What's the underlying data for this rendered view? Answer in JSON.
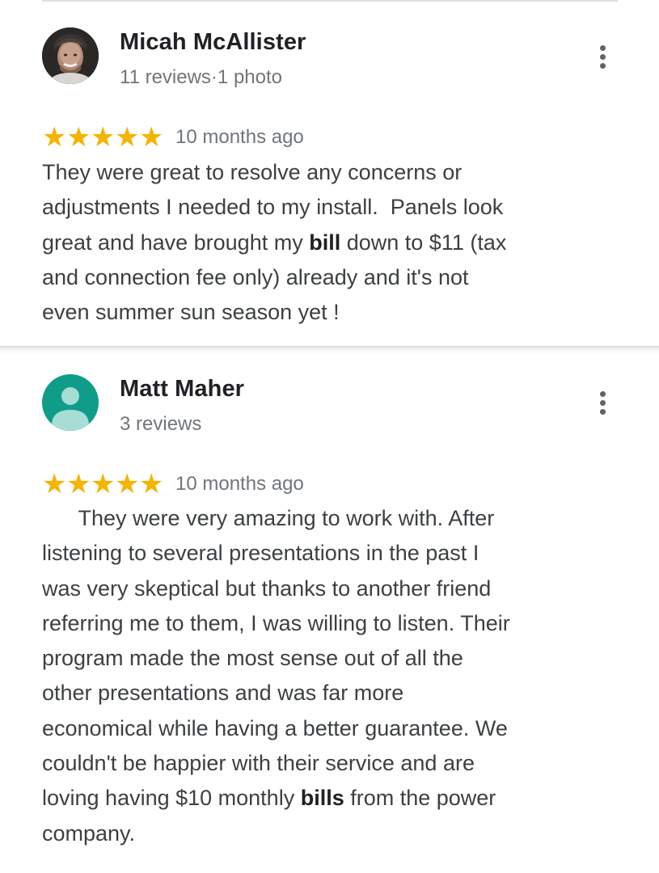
{
  "reviews": [
    {
      "reviewer_name": "Micah McAllister",
      "reviewer_meta": "11 reviews·1 photo",
      "rating": 5,
      "rating_stars": "★★★★★",
      "date": "10 months ago",
      "text_lines": [
        {
          "before": "They were great to resolve any concerns or",
          "bold": "",
          "after": ""
        },
        {
          "before": "adjustments I needed to my install.  Panels look",
          "bold": "",
          "after": ""
        },
        {
          "before": "great and have brought my ",
          "bold": "bill",
          "after": " down to $11 (tax"
        },
        {
          "before": "and connection fee only) already and it's not",
          "bold": "",
          "after": ""
        },
        {
          "before": "even summer sun season yet !",
          "bold": "",
          "after": ""
        }
      ],
      "avatar": "profile-photo"
    },
    {
      "reviewer_name": "Matt Maher",
      "reviewer_meta": "3 reviews",
      "rating": 5,
      "rating_stars": "★★★★★",
      "date": "10 months ago",
      "text_lines": [
        {
          "before": "      They were very amazing to work with. After",
          "bold": "",
          "after": ""
        },
        {
          "before": "listening to several presentations in the past I",
          "bold": "",
          "after": ""
        },
        {
          "before": "was very skeptical but thanks to another friend",
          "bold": "",
          "after": ""
        },
        {
          "before": "referring me to them, I was willing to listen. Their",
          "bold": "",
          "after": ""
        },
        {
          "before": "program made the most sense out of all the",
          "bold": "",
          "after": ""
        },
        {
          "before": "other presentations and was far more",
          "bold": "",
          "after": ""
        },
        {
          "before": "economical while having a better guarantee. We",
          "bold": "",
          "after": ""
        },
        {
          "before": "couldn't be happier with their service and are",
          "bold": "",
          "after": ""
        },
        {
          "before": "loving having $10 monthly ",
          "bold": "bills",
          "after": " from the power"
        },
        {
          "before": "company.",
          "bold": "",
          "after": ""
        }
      ],
      "avatar": "default-person",
      "avatar_color": "#0f9d8a"
    }
  ],
  "colors": {
    "star": "#f4b400",
    "name": "#202124",
    "meta": "#70757a",
    "body": "#3c4043",
    "divider": "#e0e0e0"
  },
  "icons": {
    "more": "more-vert-icon",
    "star": "star-icon",
    "default_avatar": "person-icon"
  }
}
